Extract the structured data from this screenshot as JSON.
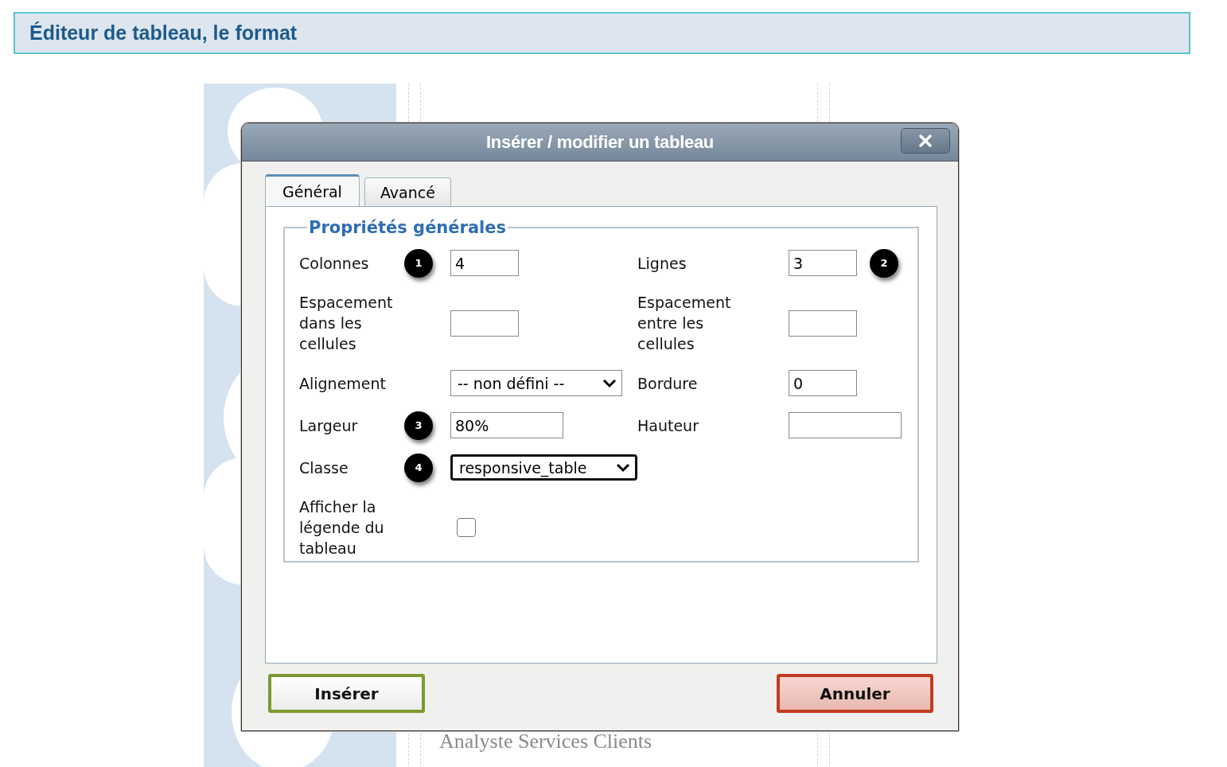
{
  "header": {
    "title": "Éditeur de tableau, le format"
  },
  "background_text": [
    "Analyste Services Clients"
  ],
  "dialog": {
    "title": "Insérer / modifier un tableau",
    "tabs": [
      {
        "label": "Général",
        "selected": true
      },
      {
        "label": "Avancé",
        "selected": false
      }
    ],
    "legend": "Propriétés générales",
    "rows": [
      {
        "fields": [
          {
            "label": "Colonnes",
            "kind": "text",
            "value": "4",
            "callout": "1",
            "focused": false
          },
          {
            "label": "Lignes",
            "kind": "text",
            "value": "3",
            "callout": "2",
            "focused": false
          }
        ]
      },
      {
        "fields": [
          {
            "label": "Espacement dans les cellules",
            "kind": "text",
            "focused": false
          },
          {
            "label": "Espacement entre les cellules",
            "kind": "text",
            "focused": false
          }
        ]
      },
      {
        "fields": [
          {
            "label": "Alignement",
            "kind": "select",
            "value": "-- non défini --",
            "focused": false
          },
          {
            "label": "Bordure",
            "kind": "text",
            "value": "0",
            "focused": false
          }
        ]
      },
      {
        "fields": [
          {
            "label": "Largeur",
            "kind": "text",
            "value": "80%",
            "callout": "3",
            "focused": false
          },
          {
            "label": "Hauteur",
            "kind": "text",
            "focused": false
          }
        ]
      },
      {
        "fields": [
          {
            "label": "Classe",
            "kind": "select",
            "value": "responsive_table",
            "callout": "4",
            "focused": true
          }
        ]
      },
      {
        "fields": [
          {
            "label": "Afficher la légende du tableau",
            "kind": "checkbox",
            "checked": false
          }
        ]
      }
    ],
    "buttons": [
      {
        "label": "Insérer",
        "kind": "confirm"
      },
      {
        "label": "Annuler",
        "kind": "cancel"
      }
    ]
  }
}
